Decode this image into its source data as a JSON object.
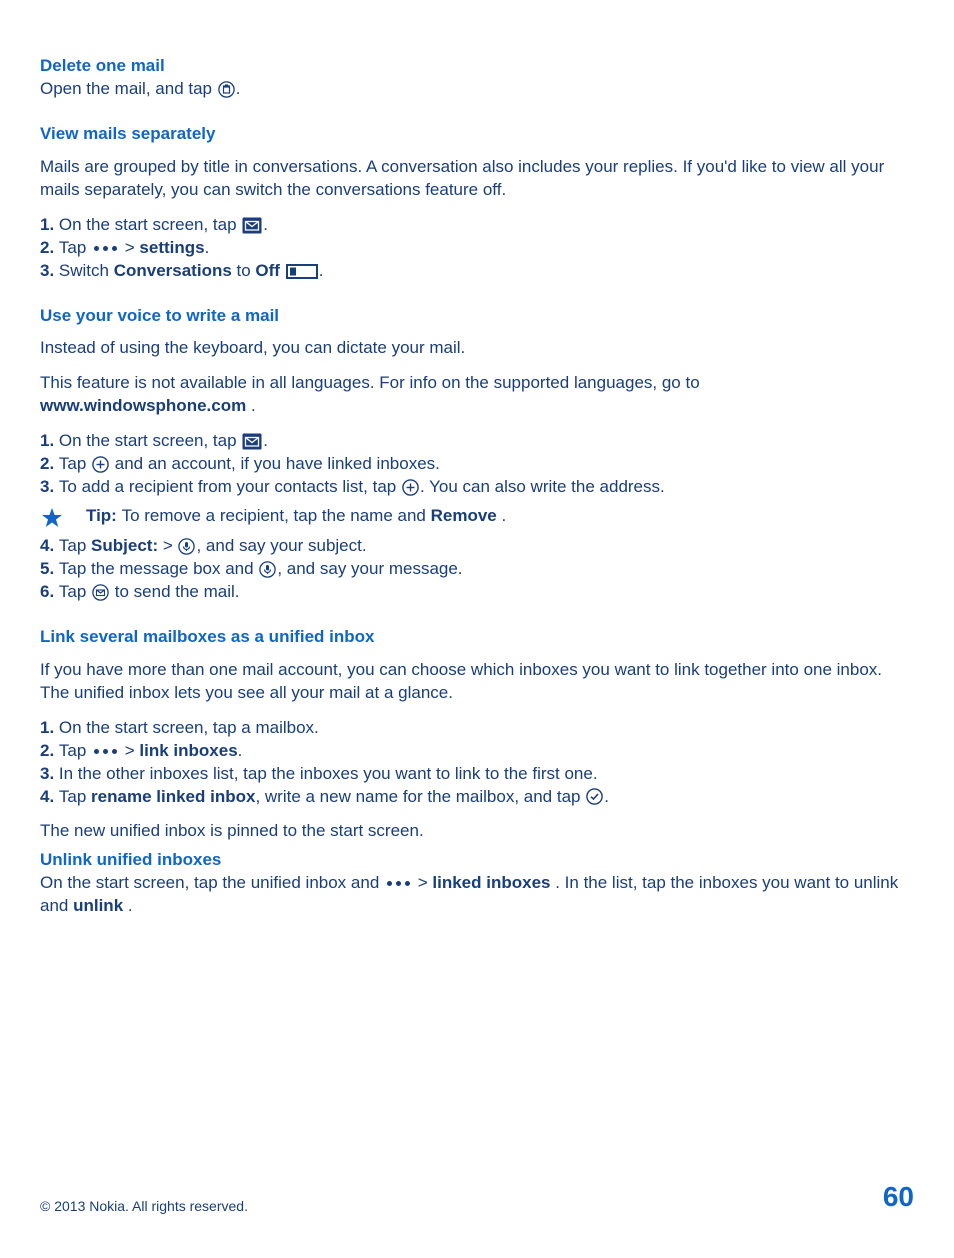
{
  "s1": {
    "title": "Delete one mail",
    "p1a": "Open the mail, and tap ",
    "p1b": "."
  },
  "s2": {
    "title": "View mails separately",
    "p1": "Mails are grouped by title in conversations. A conversation also includes your replies. If you'd like to view all your mails separately, you can switch the conversations feature off.",
    "l1n": "1. ",
    "l1a": "On the start screen, tap ",
    "l1b": ".",
    "l2n": "2. ",
    "l2a": "Tap ",
    "l2b": " > ",
    "l2c": "settings",
    "l2d": ".",
    "l3n": "3. ",
    "l3a": "Switch ",
    "l3b": "Conversations",
    "l3c": " to ",
    "l3d": "Off",
    "l3e": "."
  },
  "s3": {
    "title": "Use your voice to write a mail",
    "p1": "Instead of using the keyboard, you can dictate your mail.",
    "p2a": "This feature is not available in all languages. For info on the supported languages, go to ",
    "p2b": "www.windowsphone.com",
    "p2c": ".",
    "l1n": "1. ",
    "l1a": "On the start screen, tap ",
    "l1b": ".",
    "l2n": "2. ",
    "l2a": "Tap ",
    "l2b": " and an account, if you have linked inboxes.",
    "l3n": "3. ",
    "l3a": "To add a recipient from your contacts list, tap ",
    "l3b": ". You can also write the address.",
    "tip_label": "Tip: ",
    "tip_a": "To remove a recipient, tap the name and ",
    "tip_b": "Remove",
    "tip_c": ".",
    "l4n": "4. ",
    "l4a": "Tap ",
    "l4b": "Subject:",
    "l4c": " > ",
    "l4d": ", and say your subject.",
    "l5n": "5. ",
    "l5a": "Tap the message box and ",
    "l5b": ", and say your message.",
    "l6n": "6. ",
    "l6a": "Tap ",
    "l6b": " to send the mail."
  },
  "s4": {
    "title": "Link several mailboxes as a unified inbox",
    "p1": "If you have more than one mail account, you can choose which inboxes you want to link together into one inbox. The unified inbox lets you see all your mail at a glance.",
    "l1n": "1. ",
    "l1a": "On the start screen, tap a mailbox.",
    "l2n": "2. ",
    "l2a": "Tap ",
    "l2b": " > ",
    "l2c": "link inboxes",
    "l2d": ".",
    "l3n": "3. ",
    "l3a": "In the other inboxes list, tap the inboxes you want to link to the first one.",
    "l4n": "4. ",
    "l4a": "Tap ",
    "l4b": "rename linked inbox",
    "l4c": ", write a new name for the mailbox, and tap ",
    "l4d": ".",
    "p2": "The new unified inbox is pinned to the start screen."
  },
  "s5": {
    "title": "Unlink unified inboxes",
    "p1a": "On the start screen, tap the unified inbox and ",
    "p1b": " > ",
    "p1c": "linked inboxes",
    "p1d": ". In the list, tap the inboxes you want to unlink and ",
    "p1e": "unlink",
    "p1f": "."
  },
  "footer": {
    "copyright": "© 2013 Nokia. All rights reserved.",
    "page": "60"
  }
}
